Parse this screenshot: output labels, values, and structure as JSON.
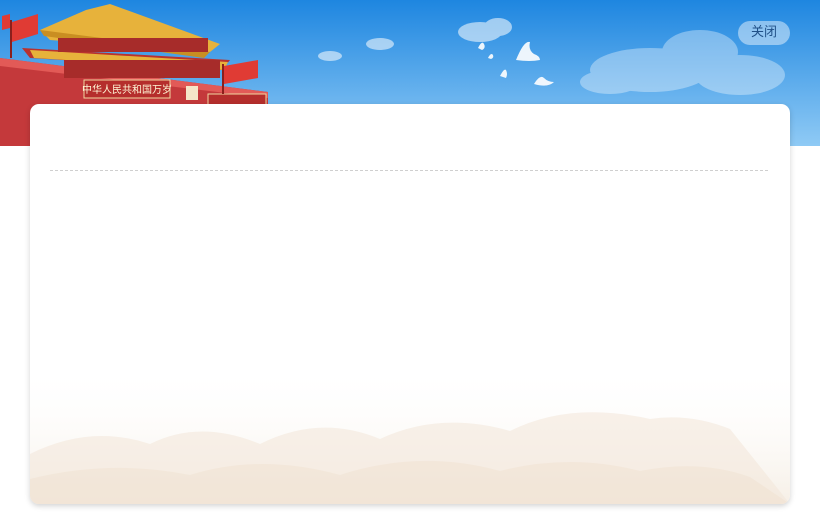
{
  "header": {
    "banner_inscription": "中华人民共和国万岁",
    "close_label": "关闭"
  },
  "colors": {
    "sky_top": "#1e86e0",
    "sky_bottom": "#8fcaf5",
    "gate_red": "#c4393b",
    "roof_gold": "#e7b23b",
    "card_background": "#ffffff",
    "divider": "#cfcfcf",
    "mountain_tint": "#f6efe6"
  },
  "icons": [
    "tiananmen-gate-illustration",
    "dove-icon",
    "cloud-icon",
    "flag-icon"
  ]
}
